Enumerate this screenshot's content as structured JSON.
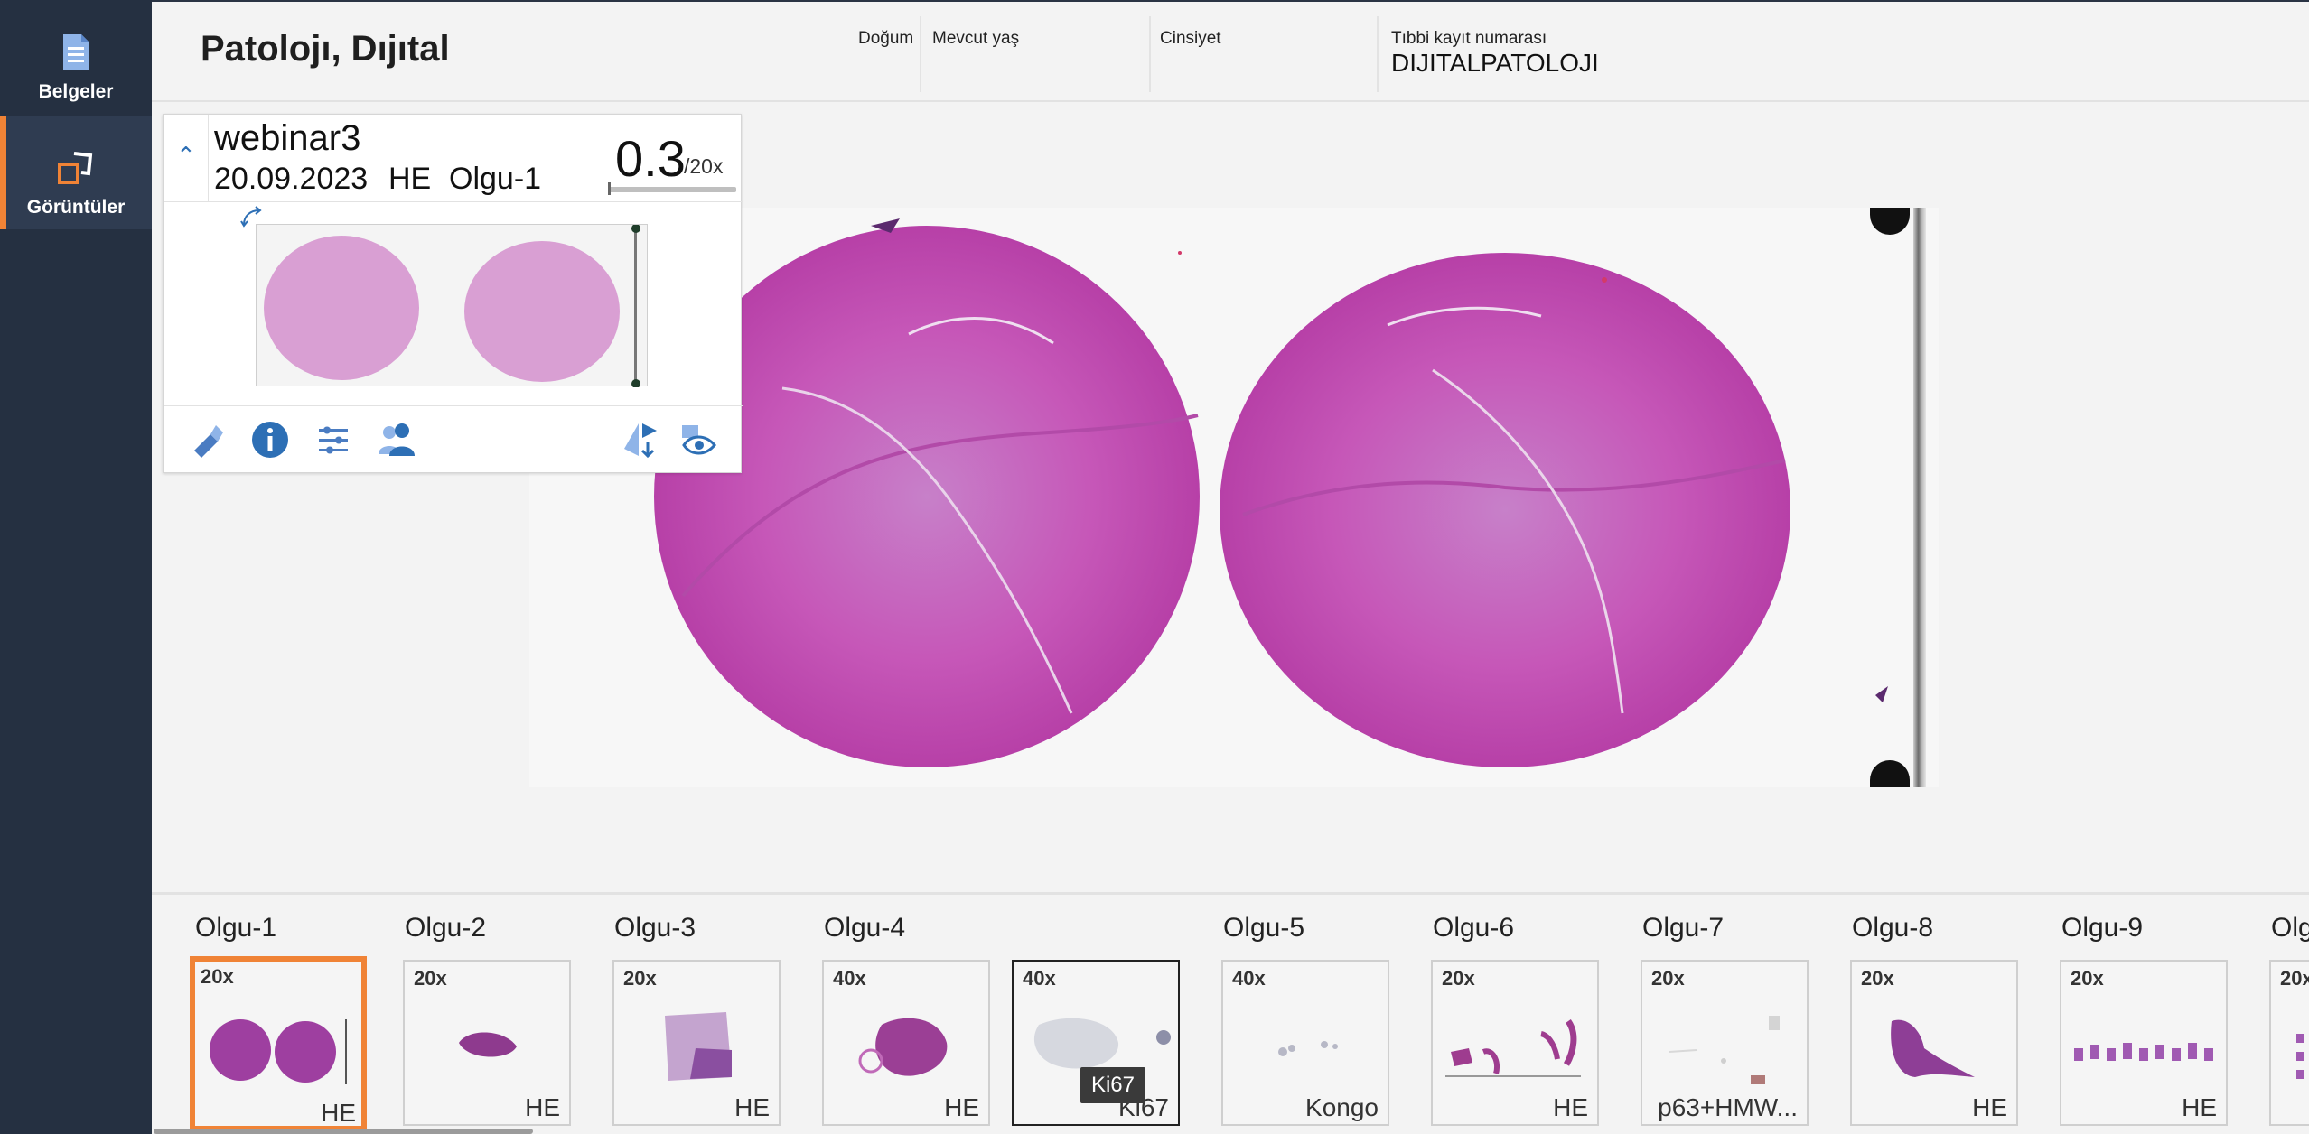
{
  "sidebar": {
    "items": [
      {
        "label": "Belgeler",
        "icon": "document-icon"
      },
      {
        "label": "Görüntüler",
        "icon": "images-icon"
      }
    ]
  },
  "patient": {
    "name": "Patolojı, Dıjıtal",
    "fields": [
      {
        "label": "Doğum",
        "value": ""
      },
      {
        "label": "Mevcut yaş",
        "value": ""
      },
      {
        "label": "Cinsiyet",
        "value": ""
      },
      {
        "label": "Tıbbi kayıt numarası",
        "value": "DIJITALPATOLOJI"
      }
    ]
  },
  "slide_panel": {
    "name": "webinar3",
    "date": "20.09.2023",
    "stain": "HE",
    "case": "Olgu-1",
    "zoom": "0.3",
    "max_zoom": "/20x",
    "tools": [
      "annotation-tool-icon",
      "info-icon",
      "adjust-sliders-icon",
      "share-users-icon",
      "flip-icon",
      "visibility-icon"
    ]
  },
  "colors": {
    "sidebar_bg": "#253041",
    "accent": "#f08336",
    "icon_blue": "#2d6fb5",
    "stain_pink": "#c94fb6"
  },
  "cases": [
    {
      "label": "Olgu-1",
      "slides": [
        {
          "mag": "20x",
          "stain": "HE",
          "selected": true
        }
      ]
    },
    {
      "label": "Olgu-2",
      "slides": [
        {
          "mag": "20x",
          "stain": "HE"
        }
      ]
    },
    {
      "label": "Olgu-3",
      "slides": [
        {
          "mag": "20x",
          "stain": "HE"
        }
      ]
    },
    {
      "label": "Olgu-4",
      "slides": [
        {
          "mag": "40x",
          "stain": "HE"
        },
        {
          "mag": "40x",
          "stain": "Ki67"
        }
      ]
    },
    {
      "label": "Olgu-5",
      "slides": [
        {
          "mag": "40x",
          "stain": "Kongo"
        }
      ]
    },
    {
      "label": "Olgu-6",
      "slides": [
        {
          "mag": "20x",
          "stain": "HE"
        }
      ]
    },
    {
      "label": "Olgu-7",
      "slides": [
        {
          "mag": "20x",
          "stain": "p63+HMW..."
        }
      ]
    },
    {
      "label": "Olgu-8",
      "slides": [
        {
          "mag": "20x",
          "stain": "HE"
        }
      ]
    },
    {
      "label": "Olgu-9",
      "slides": [
        {
          "mag": "20x",
          "stain": "HE"
        }
      ]
    },
    {
      "label": "Olg",
      "slides": [
        {
          "mag": "20x",
          "stain": ""
        }
      ]
    }
  ],
  "tooltip": "Ki67"
}
